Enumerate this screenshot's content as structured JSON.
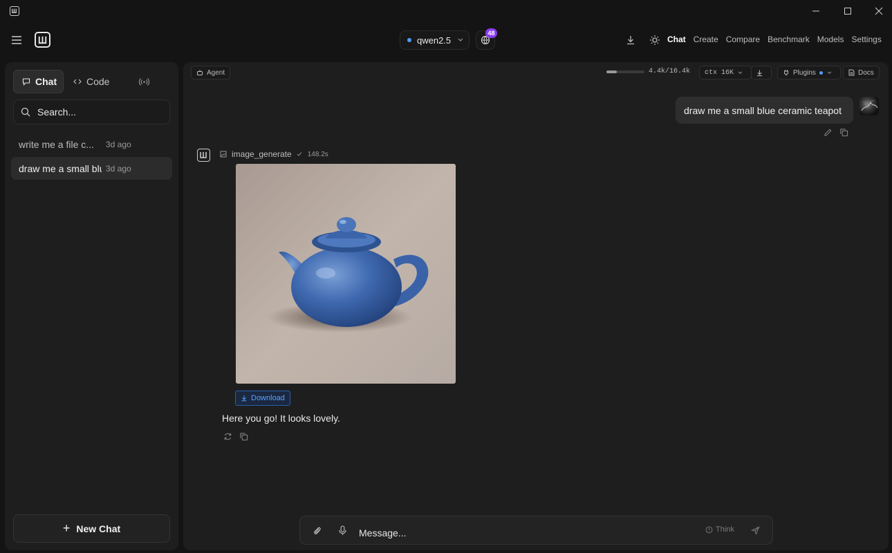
{
  "window": {
    "minimize": "minimize",
    "maximize": "maximize",
    "close": "close"
  },
  "header": {
    "model": {
      "name": "qwen2.5",
      "status_color": "#4c9dff"
    },
    "notifications_count": "48",
    "nav": [
      {
        "label": "Chat",
        "active": true
      },
      {
        "label": "Create"
      },
      {
        "label": "Compare"
      },
      {
        "label": "Benchmark"
      },
      {
        "label": "Models"
      },
      {
        "label": "Settings"
      }
    ]
  },
  "sidebar": {
    "tabs": {
      "chat": "Chat",
      "code": "Code"
    },
    "search": {
      "placeholder": "Search..."
    },
    "conversations": [
      {
        "title": "write me a file c...",
        "time": "3d ago"
      },
      {
        "title": "draw me a small blue ceramic teapot",
        "time": "3d ago",
        "active": true
      }
    ],
    "new_chat": "New Chat"
  },
  "toolbar": {
    "agent": "Agent",
    "tokens": "4.4k/16.4k",
    "tokens_used_fraction": 0.27,
    "ctx": "ctx 16K",
    "plugins": "Plugins",
    "docs": "Docs"
  },
  "conversation": {
    "user_message": "draw me a small blue ceramic teapot",
    "tool": {
      "name": "image_generate",
      "duration": "148.2s"
    },
    "download_label": "Download",
    "assistant_message": "Here you go! It looks lovely."
  },
  "composer": {
    "placeholder": "Message...",
    "think": "Think"
  },
  "colors": {
    "accent": "#4c9dff",
    "badge": "#8b3df2",
    "download": "#5aa2ff"
  }
}
